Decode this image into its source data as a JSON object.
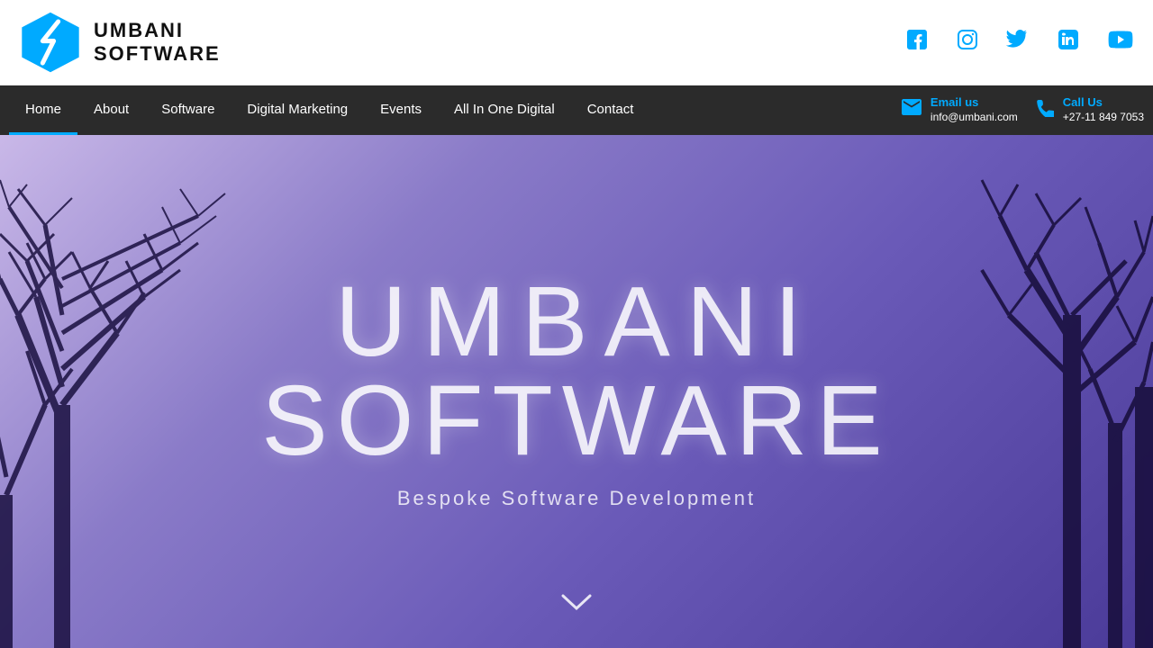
{
  "header": {
    "logo_line1": "UMBANI",
    "logo_line2": "SOFTWARE"
  },
  "social": [
    {
      "name": "facebook",
      "symbol": "f"
    },
    {
      "name": "instagram",
      "symbol": "📷"
    },
    {
      "name": "twitter",
      "symbol": "𝕏"
    },
    {
      "name": "linkedin",
      "symbol": "in"
    },
    {
      "name": "youtube",
      "symbol": "▶"
    }
  ],
  "nav": {
    "items": [
      {
        "label": "Home",
        "active": true
      },
      {
        "label": "About",
        "active": false
      },
      {
        "label": "Software",
        "active": false
      },
      {
        "label": "Digital Marketing",
        "active": false
      },
      {
        "label": "Events",
        "active": false
      },
      {
        "label": "All In One Digital",
        "active": false
      },
      {
        "label": "Contact",
        "active": false
      }
    ],
    "email_label": "Email us",
    "email_value": "info@umbani.com",
    "phone_label": "Call Us",
    "phone_value": "+27-11 849 7053"
  },
  "hero": {
    "title_line1": "UMBANI",
    "title_line2": "SOFTWARE",
    "subtitle": "Bespoke Software Development",
    "chevron": "❯"
  }
}
